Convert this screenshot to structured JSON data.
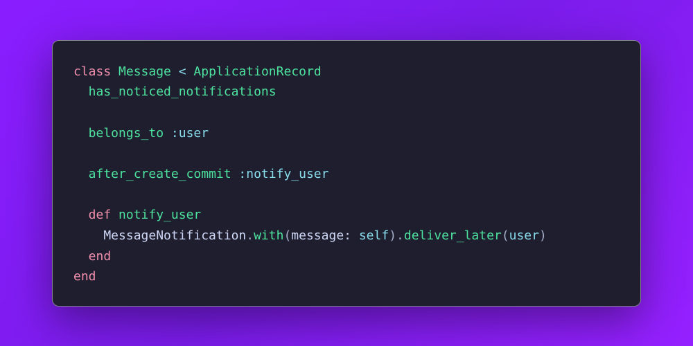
{
  "code": {
    "language": "ruby",
    "lines": [
      {
        "indent": 1,
        "tokens": [
          {
            "t": "class",
            "c": "keyword"
          },
          {
            "t": " ",
            "c": "plain"
          },
          {
            "t": "Message",
            "c": "class"
          },
          {
            "t": " ",
            "c": "plain"
          },
          {
            "t": "<",
            "c": "operator"
          },
          {
            "t": " ",
            "c": "plain"
          },
          {
            "t": "ApplicationRecord",
            "c": "class"
          }
        ]
      },
      {
        "indent": 2,
        "tokens": [
          {
            "t": "has_noticed_notifications",
            "c": "method"
          }
        ]
      },
      {
        "indent": 1,
        "blank": true
      },
      {
        "indent": 2,
        "tokens": [
          {
            "t": "belongs_to",
            "c": "method"
          },
          {
            "t": " ",
            "c": "plain"
          },
          {
            "t": ":user",
            "c": "symbol"
          }
        ]
      },
      {
        "indent": 1,
        "blank": true
      },
      {
        "indent": 2,
        "tokens": [
          {
            "t": "after_create_commit",
            "c": "method"
          },
          {
            "t": " ",
            "c": "plain"
          },
          {
            "t": ":notify_user",
            "c": "symbol"
          }
        ]
      },
      {
        "indent": 1,
        "blank": true
      },
      {
        "indent": 2,
        "tokens": [
          {
            "t": "def",
            "c": "keyword"
          },
          {
            "t": " ",
            "c": "plain"
          },
          {
            "t": "notify_user",
            "c": "method"
          }
        ]
      },
      {
        "indent": 3,
        "tokens": [
          {
            "t": "MessageNotification",
            "c": "const"
          },
          {
            "t": ".",
            "c": "punct"
          },
          {
            "t": "with",
            "c": "method"
          },
          {
            "t": "(",
            "c": "punct"
          },
          {
            "t": "message:",
            "c": "argname"
          },
          {
            "t": " ",
            "c": "plain"
          },
          {
            "t": "self",
            "c": "self"
          },
          {
            "t": ")",
            "c": "punct"
          },
          {
            "t": ".",
            "c": "punct"
          },
          {
            "t": "deliver_later",
            "c": "method"
          },
          {
            "t": "(",
            "c": "punct"
          },
          {
            "t": "user",
            "c": "param"
          },
          {
            "t": ")",
            "c": "punct"
          }
        ]
      },
      {
        "indent": 2,
        "tokens": [
          {
            "t": "end",
            "c": "keyword"
          }
        ]
      },
      {
        "indent": 1,
        "tokens": [
          {
            "t": "end",
            "c": "keyword"
          }
        ]
      }
    ]
  }
}
